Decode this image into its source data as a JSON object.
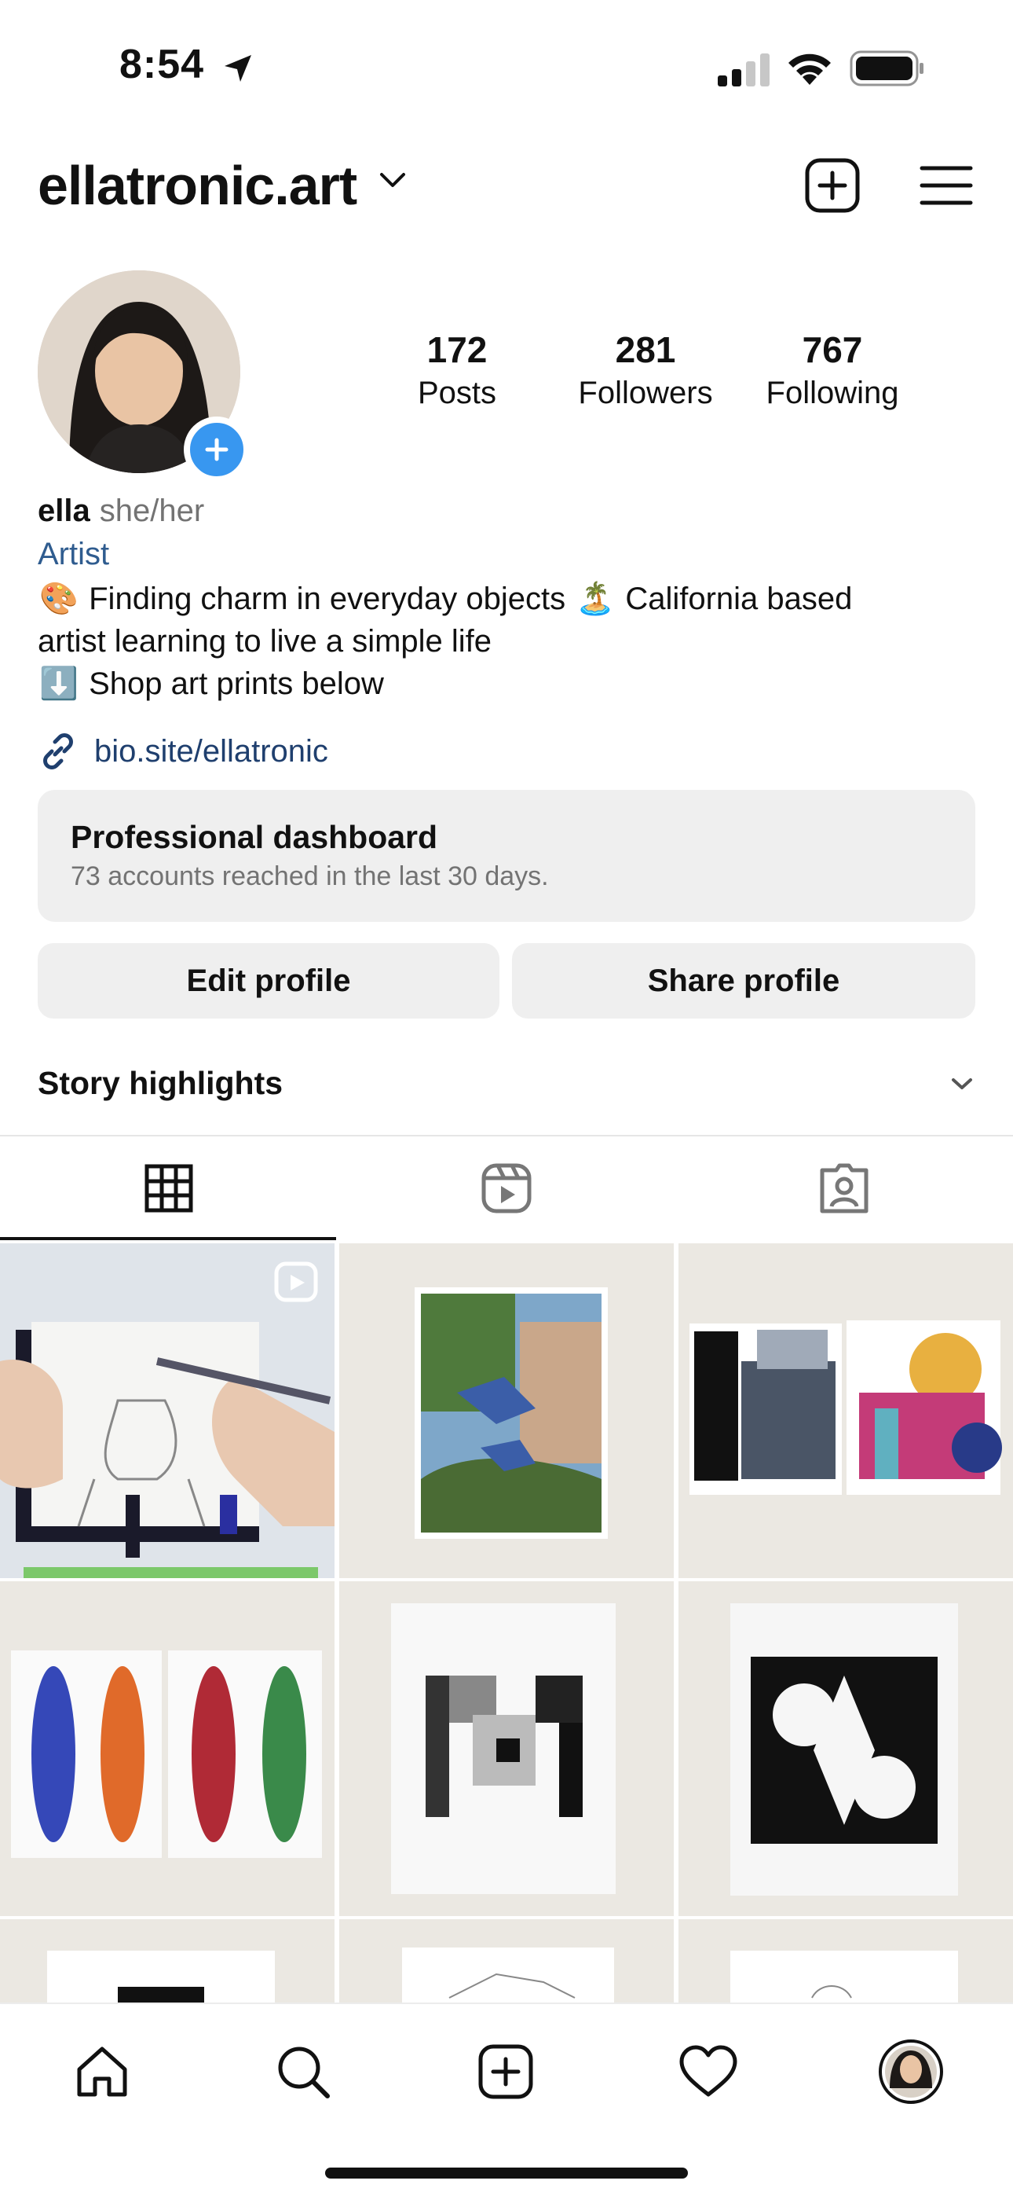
{
  "status_bar": {
    "time": "8:54"
  },
  "header": {
    "username": "ellatronic.art"
  },
  "stats": [
    {
      "value": "172",
      "label": "Posts"
    },
    {
      "value": "281",
      "label": "Followers"
    },
    {
      "value": "767",
      "label": "Following"
    }
  ],
  "profile": {
    "name": "ella",
    "pronouns": "she/her",
    "category": "Artist",
    "bio_line1_emoji1": "🎨",
    "bio_line1_text1": "Finding charm in everyday objects",
    "bio_line1_emoji2": "🏝️",
    "bio_line1_text2": "California based",
    "bio_line2": "artist learning to live a simple life",
    "bio_line3_emoji": "⬇️",
    "bio_line3_text": "Shop art prints below",
    "link": "bio.site/ellatronic"
  },
  "dashboard": {
    "title": "Professional dashboard",
    "subtitle": "73 accounts reached in the last 30 days."
  },
  "buttons": {
    "edit": "Edit profile",
    "share": "Share profile"
  },
  "highlights": {
    "label": "Story highlights"
  },
  "tabs": [
    {
      "icon": "grid-icon",
      "selected": true
    },
    {
      "icon": "reels-icon",
      "selected": false
    },
    {
      "icon": "tagged-icon",
      "selected": false
    }
  ],
  "nav": [
    "home-icon",
    "search-icon",
    "create-icon",
    "heart-icon",
    "profile-avatar"
  ],
  "colors": {
    "accent_blue": "#3897f0",
    "link_blue": "#1f3f6e",
    "category_blue": "#2f5c8f",
    "panel_gray": "#efefef"
  }
}
